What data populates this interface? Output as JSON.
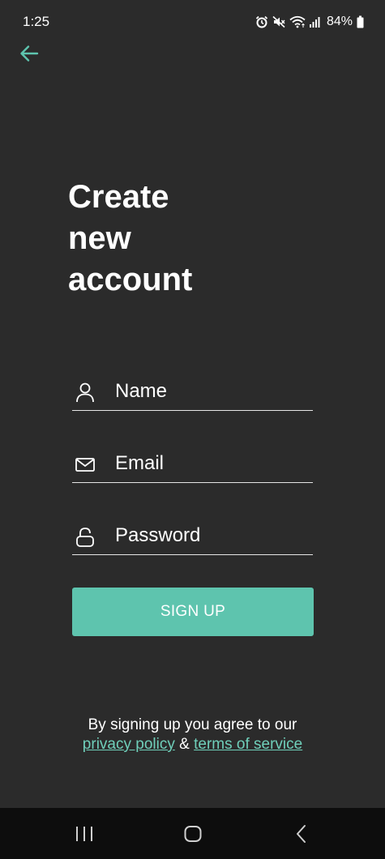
{
  "status_bar": {
    "time": "1:25",
    "battery": "84%",
    "icons": [
      "alarm-icon",
      "mute-icon",
      "wifi-icon",
      "signal-icon",
      "battery-icon"
    ]
  },
  "header": {
    "back_icon": "arrow-left-icon"
  },
  "title": "Create\nnew\naccount",
  "form": {
    "name": {
      "placeholder": "Name",
      "icon": "user-icon"
    },
    "email": {
      "placeholder": "Email",
      "icon": "mail-icon"
    },
    "password": {
      "placeholder": "Password",
      "icon": "lock-icon"
    },
    "submit_label": "SIGN UP"
  },
  "footer": {
    "agreement_text": "By signing up you agree to our",
    "privacy_link": "privacy policy",
    "and": "&",
    "terms_link": "terms of service"
  },
  "nav": {
    "items": [
      "recent-apps",
      "home",
      "back"
    ]
  },
  "colors": {
    "background": "#2b2b2b",
    "accent": "#5ec4ae",
    "link": "#6fcfba",
    "nav_bar": "#0d0d0d"
  }
}
